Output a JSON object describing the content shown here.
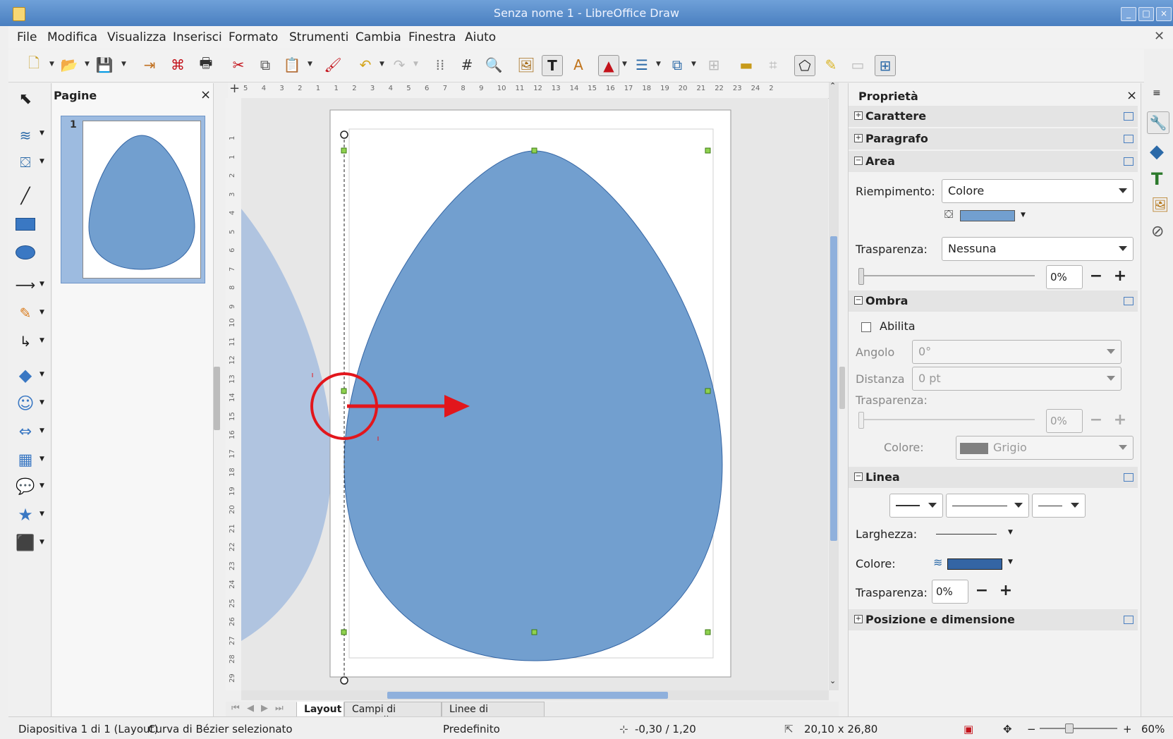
{
  "window": {
    "title": "Senza nome 1 - LibreOffice Draw"
  },
  "menubar": [
    "File",
    "Modifica",
    "Visualizza",
    "Inserisci",
    "Formato",
    "Strumenti",
    "Cambia",
    "Finestra",
    "Aiuto"
  ],
  "pages_pane": {
    "title": "Pagine",
    "close": "×",
    "pages": [
      {
        "number": "1"
      }
    ]
  },
  "rulers": {
    "horizontal": [
      "5",
      "4",
      "3",
      "2",
      "1",
      "1",
      "2",
      "3",
      "4",
      "5",
      "6",
      "7",
      "8",
      "9",
      "10",
      "11",
      "12",
      "13",
      "14",
      "15",
      "16",
      "17",
      "18",
      "19",
      "20",
      "21",
      "22",
      "23",
      "24",
      "2"
    ],
    "vertical": [
      "1",
      "1",
      "2",
      "3",
      "4",
      "5",
      "6",
      "7",
      "8",
      "9",
      "10",
      "11",
      "12",
      "13",
      "14",
      "15",
      "16",
      "17",
      "18",
      "19",
      "20",
      "21",
      "22",
      "23",
      "24",
      "25",
      "26",
      "27",
      "28",
      "29"
    ]
  },
  "tabs": {
    "items": [
      {
        "label": "Layout",
        "active": true
      },
      {
        "label": "Campi di controllo",
        "active": false
      },
      {
        "label": "Linee di quotatura",
        "active": false
      }
    ]
  },
  "sidebar": {
    "title": "Proprietà",
    "close": "×",
    "sections": {
      "carattere": {
        "label": "Carattere",
        "expanded": false
      },
      "paragrafo": {
        "label": "Paragrafo",
        "expanded": false
      },
      "area": {
        "label": "Area",
        "expanded": true,
        "fill_label": "Riempimento:",
        "fill_value": "Colore",
        "fill_color": "#729fcf",
        "transparency_label": "Trasparenza:",
        "transparency_value": "Nessuna",
        "transparency_percent": "0%"
      },
      "ombra": {
        "label": "Ombra",
        "expanded": true,
        "enable_label": "Abilita",
        "enabled": false,
        "angle_label": "Angolo",
        "angle_value": "0°",
        "distance_label": "Distanza",
        "distance_value": "0 pt",
        "transparency_label": "Trasparenza:",
        "transparency_value": "0%",
        "color_label": "Colore:",
        "color_value": "Grigio",
        "color_swatch": "#808080"
      },
      "linea": {
        "label": "Linea",
        "expanded": true,
        "width_label": "Larghezza:",
        "color_label": "Colore:",
        "color_swatch": "#3465a4",
        "transparency_label": "Trasparenza:",
        "transparency_value": "0%"
      },
      "posizione": {
        "label": "Posizione e dimensione",
        "expanded": false
      }
    }
  },
  "statusbar": {
    "slide": "Diapositiva 1 di 1 (Layout)",
    "selection": "Curva di Bézier selezionato",
    "master": "Predefinito",
    "position": "-0,30 / 1,20",
    "size": "20,10 x 26,80",
    "zoom": "60%"
  },
  "colors": {
    "shape_fill": "#729fcf",
    "shape_stroke": "#3465a4",
    "annotation": "#e2161c"
  }
}
